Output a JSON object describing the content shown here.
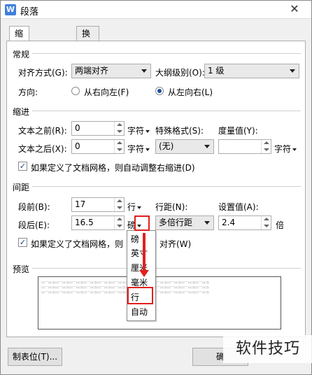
{
  "title": "段落",
  "app_icon_letter": "W",
  "close_glyph": "✕",
  "tabs": [
    "缩进和间距(I)",
    "换行和分页(P)"
  ],
  "general": {
    "section": "常规",
    "align_label": "对齐方式(G):",
    "align_value": "两端对齐",
    "outline_label": "大纲级别(O):",
    "outline_value": "1 级",
    "direction_label": "方向:",
    "rtl_label": "从右向左(F)",
    "ltr_label": "从左向右(L)"
  },
  "indent": {
    "section": "缩进",
    "before_label": "文本之前(R):",
    "before_value": "0",
    "before_unit": "字符",
    "after_label": "文本之后(X):",
    "after_value": "0",
    "after_unit": "字符",
    "special_label": "特殊格式(S):",
    "special_value": "(无)",
    "measure_label": "度量值(Y):",
    "measure_value": "",
    "measure_unit": "字符",
    "grid_checkbox": "如果定义了文档网格，则自动调整右缩进(D)"
  },
  "spacing": {
    "section": "间距",
    "before_label": "段前(B):",
    "before_value": "17",
    "before_unit": "行",
    "after_label": "段后(E):",
    "after_value": "16.5",
    "after_unit": "磅",
    "line_label": "行距(N):",
    "line_value": "多倍行距",
    "set_label": "设置值(A):",
    "set_value": "2.4",
    "set_unit": "倍",
    "grid_checkbox_a": "如果定义了文档网格，则",
    "grid_checkbox_b": "对齐(W)"
  },
  "preview": {
    "section": "预览",
    "sample_text": "前一段落前一段落前一段落前一段落前一段落前一段落前一段落前一段落前一段落前一段落前一段落前一段落"
  },
  "unit_dropdown": {
    "options": [
      "磅",
      "英寸",
      "厘米",
      "毫米",
      "行",
      "自动"
    ]
  },
  "buttons": {
    "tabs_button": "制表位(T)...",
    "ok_button": "确"
  },
  "watermark": "软件技巧",
  "colors": {
    "highlight": "#e02020",
    "panel": "#ffffff",
    "window": "#f0f0f0"
  }
}
